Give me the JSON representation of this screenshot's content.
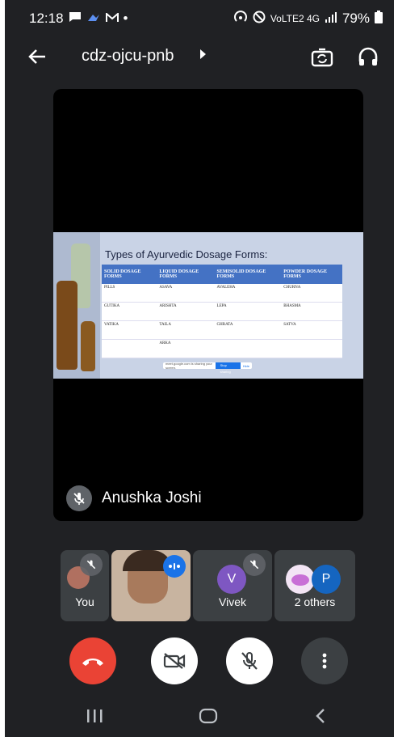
{
  "status_bar": {
    "time": "12:18",
    "notification_dot": "•",
    "network_label": "VoLTE2 4G",
    "battery": "79%"
  },
  "top_bar": {
    "meeting_code": "cdz-ojcu-pnb"
  },
  "main_tile": {
    "participant_name": "Anushka Joshi",
    "slide": {
      "title": "Types of Ayurvedic Dosage Forms:",
      "headers": [
        "SOLID DOSAGE FORMS",
        "LIQUID DOSAGE FORMS",
        "SEMISOLID DOSAGE FORMS",
        "POWDER DOSAGE FORMS"
      ],
      "rows": [
        [
          "PILLS",
          "ASAVA",
          "AVALEHA",
          "CHURNA"
        ],
        [
          "GUTIKA",
          "ARISHTA",
          "LEPA",
          "BHASMA"
        ],
        [
          "VATIKA",
          "TAILA",
          "GHRATA",
          "SATVA"
        ],
        [
          "",
          "ARKA",
          "",
          ""
        ]
      ],
      "share_bar": {
        "text": "meet.google.com is sharing your screen.",
        "stop": "Stop sharing",
        "hide": "Hide"
      }
    }
  },
  "participants": [
    {
      "label": "You"
    },
    {
      "label": ""
    },
    {
      "label": "Vivek",
      "initial": "V",
      "color": "#7e57c2"
    },
    {
      "label": "2 others",
      "initial": "P",
      "color": "#1565c0"
    }
  ],
  "colors": {
    "background": "#202124",
    "tile": "#3c4043",
    "end_call": "#ea4335",
    "speaking": "#1a73e8"
  }
}
